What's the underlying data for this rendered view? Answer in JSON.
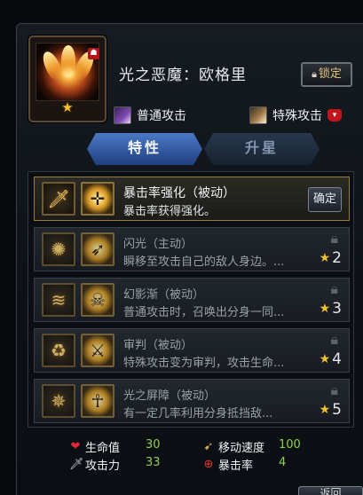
{
  "hero": {
    "name": "光之恶魔：欧格里",
    "star_count": 1,
    "lock_label": "锁定"
  },
  "attacks": {
    "normal_label": "普通攻击",
    "special_label": "特殊攻击"
  },
  "tabs": [
    {
      "label": "特性",
      "active": true
    },
    {
      "label": "升星",
      "active": false
    }
  ],
  "skills": [
    {
      "name": "暴击率强化（被动）",
      "desc": "暴击率获得强化。",
      "unlocked": true,
      "button_label": "确定",
      "type_icon": "sword-icon",
      "skill_icon": "crosshair-icon"
    },
    {
      "name": "闪光（主动）",
      "desc": "瞬移至攻击自己的敌人身边。...",
      "unlocked": false,
      "required_stars": "2",
      "type_icon": "sunburst-icon",
      "skill_icon": "dash-icon"
    },
    {
      "name": "幻影渐（被动）",
      "desc": "普通攻击时，召唤出分身一同...",
      "unlocked": false,
      "required_stars": "3",
      "type_icon": "slash-icon",
      "skill_icon": "skull-icon"
    },
    {
      "name": "审判（被动）",
      "desc": "特殊攻击变为审判，攻击生命...",
      "unlocked": false,
      "required_stars": "4",
      "type_icon": "cycle-icon",
      "skill_icon": "crossed-blades-icon"
    },
    {
      "name": "光之屏障（被动）",
      "desc": "有一定几率利用分身抵挡敌...",
      "unlocked": false,
      "required_stars": "5",
      "type_icon": "shuriken-icon",
      "skill_icon": "body-icon"
    }
  ],
  "stats": {
    "hp_label": "生命值",
    "hp_value": "30",
    "speed_label": "移动速度",
    "speed_value": "100",
    "atk_label": "攻击力",
    "atk_value": "33",
    "crit_label": "暴击率",
    "crit_value": "4"
  },
  "bottom_button_label": "返回",
  "colors": {
    "accent_gold": "#f2c12e",
    "stat_value_green": "#8fd04b",
    "tab_active_blue": "#3a63ad",
    "devil_red": "#c1161d"
  }
}
